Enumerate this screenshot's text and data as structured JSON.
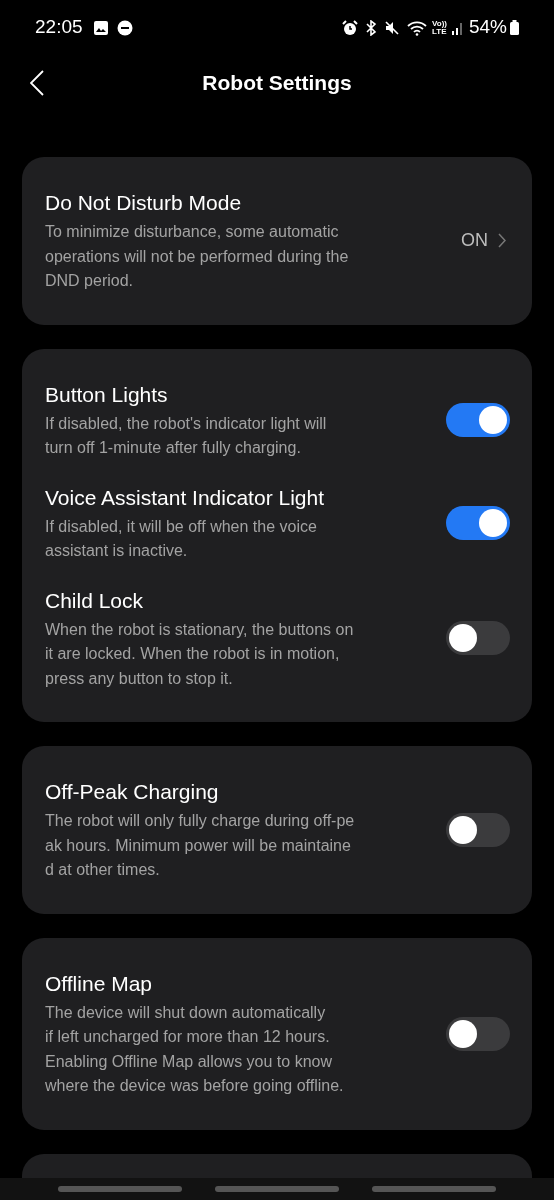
{
  "status_bar": {
    "time": "22:05",
    "volte": [
      "Vo))",
      "LTE"
    ],
    "battery": "54%"
  },
  "header": {
    "title": "Robot Settings"
  },
  "groups": [
    {
      "items": [
        {
          "kind": "link",
          "title": "Do Not Disturb Mode",
          "description": [
            "To minimize disturbance, some automatic",
            "operations will not be performed during the",
            "DND period."
          ],
          "value": "ON"
        }
      ]
    },
    {
      "items": [
        {
          "kind": "toggle",
          "title": "Button Lights",
          "description": [
            "If disabled, the robot's indicator light will",
            "turn off 1-minute after fully charging."
          ],
          "on": true
        },
        {
          "kind": "toggle",
          "title": "Voice Assistant Indicator Light",
          "description": [
            "If disabled, it will be off when the voice",
            "assistant is inactive."
          ],
          "on": true
        },
        {
          "kind": "toggle",
          "title": "Child Lock",
          "description": [
            "When the robot is stationary, the buttons on",
            "it are locked. When the robot is in motion,",
            "press any button to stop it."
          ],
          "on": false
        }
      ]
    },
    {
      "items": [
        {
          "kind": "toggle",
          "title": "Off-Peak Charging",
          "description": [
            "The robot will only fully charge during off-pe",
            "ak hours. Minimum power will be maintaine",
            "d at other times."
          ],
          "on": false
        }
      ]
    },
    {
      "items": [
        {
          "kind": "toggle",
          "title": "Offline Map",
          "description": [
            "The device will shut down automatically",
            "if left uncharged for more than 12 hours.",
            "Enabling Offline Map allows you to know",
            "where the device was before going offline."
          ],
          "on": false
        }
      ]
    }
  ]
}
